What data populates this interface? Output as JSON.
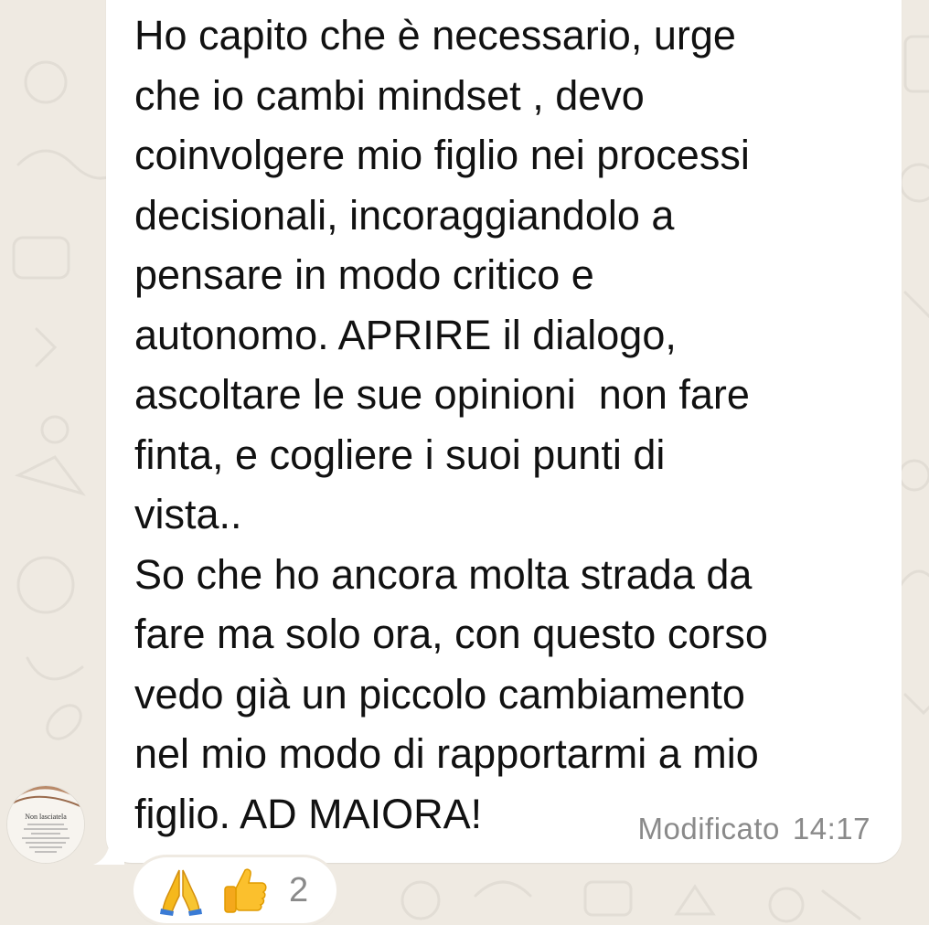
{
  "chat": {
    "message": {
      "text": "Ho capito che è necessario, urge\nche io cambi mindset , devo\ncoinvolgere mio figlio nei processi\ndecisionali, incoraggiandolo a\npensare in modo critico e\nautonomo. APRIRE il dialogo,\nascoltare le sue opinioni  non fare\nfinta, e cogliere i suoi punti di\nvista..\nSo che ho ancora molta strada da\nfare ma solo ora, con questo corso\nvedo già un piccolo cambiamento\nnel mio modo di rapportarmi a mio\nfiglio. AD MAIORA!",
      "edited_label": "Modificato",
      "time": "14:17",
      "bubble_color": "#ffffff",
      "text_color": "#111111",
      "meta_color": "#8a8a8a"
    },
    "sender": {
      "avatar_icon": "avatar-photo",
      "avatar_caption_title": "Non lasciatela"
    },
    "reactions": {
      "emojis": [
        "folded-hands-icon",
        "thumbs-up-icon"
      ],
      "count": "2"
    },
    "background_color": "#efeae2"
  }
}
